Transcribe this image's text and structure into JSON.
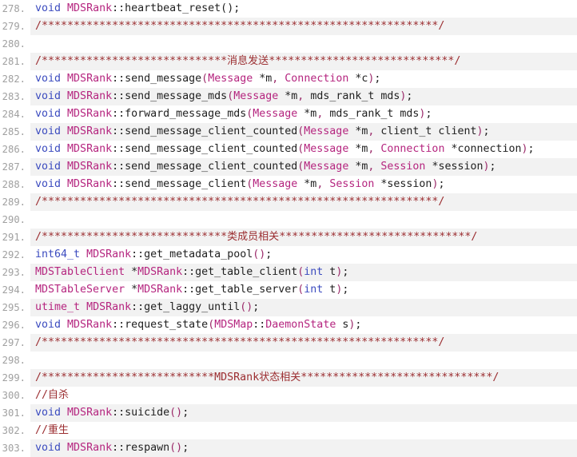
{
  "editor": {
    "language": "cpp",
    "first_line": 278,
    "last_line": 303,
    "gutter_separator": ".",
    "colors": {
      "background": "#ffffff",
      "stripe": "#f2f2f2",
      "line_number": "#a0a0a0",
      "keyword": "#3b4bbf",
      "class_name": "#b5257f",
      "comment": "#9b2d30",
      "punctuation": "#9b2a6a",
      "text": "#1f1f1f"
    }
  },
  "lines": [
    {
      "number": "278.",
      "tokens": [
        {
          "t": "void",
          "c": "kw"
        },
        {
          "t": " ",
          "c": "plain"
        },
        {
          "t": "MDSRank",
          "c": "cls"
        },
        {
          "t": "::heartbeat_reset();",
          "c": "plain"
        }
      ]
    },
    {
      "number": "279.",
      "tokens": [
        {
          "t": "/**************************************************************/",
          "c": "cmt"
        }
      ]
    },
    {
      "number": "280.",
      "tokens": []
    },
    {
      "number": "281.",
      "tokens": [
        {
          "t": "/*****************************",
          "c": "cmt"
        },
        {
          "t": "消息发送",
          "c": "cmt-cjk"
        },
        {
          "t": "*****************************/",
          "c": "cmt"
        }
      ]
    },
    {
      "number": "282.",
      "tokens": [
        {
          "t": "void",
          "c": "kw"
        },
        {
          "t": " ",
          "c": "plain"
        },
        {
          "t": "MDSRank",
          "c": "cls"
        },
        {
          "t": "::send_message",
          "c": "plain"
        },
        {
          "t": "(",
          "c": "punc"
        },
        {
          "t": "Message",
          "c": "cls"
        },
        {
          "t": " *m",
          "c": "plain"
        },
        {
          "t": ",",
          "c": "punc"
        },
        {
          "t": " ",
          "c": "plain"
        },
        {
          "t": "Connection",
          "c": "cls"
        },
        {
          "t": " *c",
          "c": "plain"
        },
        {
          "t": ")",
          "c": "punc"
        },
        {
          "t": ";",
          "c": "plain"
        }
      ]
    },
    {
      "number": "283.",
      "tokens": [
        {
          "t": "void",
          "c": "kw"
        },
        {
          "t": " ",
          "c": "plain"
        },
        {
          "t": "MDSRank",
          "c": "cls"
        },
        {
          "t": "::send_message_mds",
          "c": "plain"
        },
        {
          "t": "(",
          "c": "punc"
        },
        {
          "t": "Message",
          "c": "cls"
        },
        {
          "t": " *m",
          "c": "plain"
        },
        {
          "t": ",",
          "c": "punc"
        },
        {
          "t": " mds_rank_t mds",
          "c": "plain"
        },
        {
          "t": ")",
          "c": "punc"
        },
        {
          "t": ";",
          "c": "plain"
        }
      ]
    },
    {
      "number": "284.",
      "tokens": [
        {
          "t": "void",
          "c": "kw"
        },
        {
          "t": " ",
          "c": "plain"
        },
        {
          "t": "MDSRank",
          "c": "cls"
        },
        {
          "t": "::forward_message_mds",
          "c": "plain"
        },
        {
          "t": "(",
          "c": "punc"
        },
        {
          "t": "Message",
          "c": "cls"
        },
        {
          "t": " *m",
          "c": "plain"
        },
        {
          "t": ",",
          "c": "punc"
        },
        {
          "t": " mds_rank_t mds",
          "c": "plain"
        },
        {
          "t": ")",
          "c": "punc"
        },
        {
          "t": ";",
          "c": "plain"
        }
      ]
    },
    {
      "number": "285.",
      "tokens": [
        {
          "t": "void",
          "c": "kw"
        },
        {
          "t": " ",
          "c": "plain"
        },
        {
          "t": "MDSRank",
          "c": "cls"
        },
        {
          "t": "::send_message_client_counted",
          "c": "plain"
        },
        {
          "t": "(",
          "c": "punc"
        },
        {
          "t": "Message",
          "c": "cls"
        },
        {
          "t": " *m",
          "c": "plain"
        },
        {
          "t": ",",
          "c": "punc"
        },
        {
          "t": " client_t client",
          "c": "plain"
        },
        {
          "t": ")",
          "c": "punc"
        },
        {
          "t": ";",
          "c": "plain"
        }
      ]
    },
    {
      "number": "286.",
      "tokens": [
        {
          "t": "void",
          "c": "kw"
        },
        {
          "t": " ",
          "c": "plain"
        },
        {
          "t": "MDSRank",
          "c": "cls"
        },
        {
          "t": "::send_message_client_counted",
          "c": "plain"
        },
        {
          "t": "(",
          "c": "punc"
        },
        {
          "t": "Message",
          "c": "cls"
        },
        {
          "t": " *m",
          "c": "plain"
        },
        {
          "t": ",",
          "c": "punc"
        },
        {
          "t": " ",
          "c": "plain"
        },
        {
          "t": "Connection",
          "c": "cls"
        },
        {
          "t": " *connection",
          "c": "plain"
        },
        {
          "t": ")",
          "c": "punc"
        },
        {
          "t": ";",
          "c": "plain"
        }
      ]
    },
    {
      "number": "287.",
      "tokens": [
        {
          "t": "void",
          "c": "kw"
        },
        {
          "t": " ",
          "c": "plain"
        },
        {
          "t": "MDSRank",
          "c": "cls"
        },
        {
          "t": "::send_message_client_counted",
          "c": "plain"
        },
        {
          "t": "(",
          "c": "punc"
        },
        {
          "t": "Message",
          "c": "cls"
        },
        {
          "t": " *m",
          "c": "plain"
        },
        {
          "t": ",",
          "c": "punc"
        },
        {
          "t": " ",
          "c": "plain"
        },
        {
          "t": "Session",
          "c": "cls"
        },
        {
          "t": " *session",
          "c": "plain"
        },
        {
          "t": ")",
          "c": "punc"
        },
        {
          "t": ";",
          "c": "plain"
        }
      ]
    },
    {
      "number": "288.",
      "tokens": [
        {
          "t": "void",
          "c": "kw"
        },
        {
          "t": " ",
          "c": "plain"
        },
        {
          "t": "MDSRank",
          "c": "cls"
        },
        {
          "t": "::send_message_client",
          "c": "plain"
        },
        {
          "t": "(",
          "c": "punc"
        },
        {
          "t": "Message",
          "c": "cls"
        },
        {
          "t": " *m",
          "c": "plain"
        },
        {
          "t": ",",
          "c": "punc"
        },
        {
          "t": " ",
          "c": "plain"
        },
        {
          "t": "Session",
          "c": "cls"
        },
        {
          "t": " *session",
          "c": "plain"
        },
        {
          "t": ")",
          "c": "punc"
        },
        {
          "t": ";",
          "c": "plain"
        }
      ]
    },
    {
      "number": "289.",
      "tokens": [
        {
          "t": "/**************************************************************/",
          "c": "cmt"
        }
      ]
    },
    {
      "number": "290.",
      "tokens": []
    },
    {
      "number": "291.",
      "tokens": [
        {
          "t": "/*****************************",
          "c": "cmt"
        },
        {
          "t": "类成员相关",
          "c": "cmt-cjk"
        },
        {
          "t": "******************************/",
          "c": "cmt"
        }
      ]
    },
    {
      "number": "292.",
      "tokens": [
        {
          "t": "int64_t",
          "c": "kw"
        },
        {
          "t": " ",
          "c": "plain"
        },
        {
          "t": "MDSRank",
          "c": "cls"
        },
        {
          "t": "::get_metadata_pool",
          "c": "plain"
        },
        {
          "t": "(",
          "c": "punc"
        },
        {
          "t": ")",
          "c": "punc"
        },
        {
          "t": ";",
          "c": "plain"
        }
      ]
    },
    {
      "number": "293.",
      "tokens": [
        {
          "t": "MDSTableClient",
          "c": "cls"
        },
        {
          "t": " *",
          "c": "plain"
        },
        {
          "t": "MDSRank",
          "c": "cls"
        },
        {
          "t": "::get_table_client",
          "c": "plain"
        },
        {
          "t": "(",
          "c": "punc"
        },
        {
          "t": "int",
          "c": "kw"
        },
        {
          "t": " t",
          "c": "plain"
        },
        {
          "t": ")",
          "c": "punc"
        },
        {
          "t": ";",
          "c": "plain"
        }
      ]
    },
    {
      "number": "294.",
      "tokens": [
        {
          "t": "MDSTableServer",
          "c": "cls"
        },
        {
          "t": " *",
          "c": "plain"
        },
        {
          "t": "MDSRank",
          "c": "cls"
        },
        {
          "t": "::get_table_server",
          "c": "plain"
        },
        {
          "t": "(",
          "c": "punc"
        },
        {
          "t": "int",
          "c": "kw"
        },
        {
          "t": " t",
          "c": "plain"
        },
        {
          "t": ")",
          "c": "punc"
        },
        {
          "t": ";",
          "c": "plain"
        }
      ]
    },
    {
      "number": "295.",
      "tokens": [
        {
          "t": "utime_t",
          "c": "cls"
        },
        {
          "t": " ",
          "c": "plain"
        },
        {
          "t": "MDSRank",
          "c": "cls"
        },
        {
          "t": "::get_laggy_until",
          "c": "plain"
        },
        {
          "t": "(",
          "c": "punc"
        },
        {
          "t": ")",
          "c": "punc"
        },
        {
          "t": ";",
          "c": "plain"
        }
      ]
    },
    {
      "number": "296.",
      "tokens": [
        {
          "t": "void",
          "c": "kw"
        },
        {
          "t": " ",
          "c": "plain"
        },
        {
          "t": "MDSRank",
          "c": "cls"
        },
        {
          "t": "::request_state",
          "c": "plain"
        },
        {
          "t": "(",
          "c": "punc"
        },
        {
          "t": "MDSMap",
          "c": "cls"
        },
        {
          "t": "::",
          "c": "plain"
        },
        {
          "t": "DaemonState",
          "c": "cls"
        },
        {
          "t": " s",
          "c": "plain"
        },
        {
          "t": ")",
          "c": "punc"
        },
        {
          "t": ";",
          "c": "plain"
        }
      ]
    },
    {
      "number": "297.",
      "tokens": [
        {
          "t": "/**************************************************************/",
          "c": "cmt"
        }
      ]
    },
    {
      "number": "298.",
      "tokens": []
    },
    {
      "number": "299.",
      "tokens": [
        {
          "t": "/***************************",
          "c": "cmt"
        },
        {
          "t": "MDSRank",
          "c": "cmt"
        },
        {
          "t": "状态相关",
          "c": "cmt-cjk"
        },
        {
          "t": "******************************/",
          "c": "cmt"
        }
      ]
    },
    {
      "number": "300.",
      "tokens": [
        {
          "t": "//",
          "c": "cmt"
        },
        {
          "t": "自杀",
          "c": "cmt-cjk"
        }
      ]
    },
    {
      "number": "301.",
      "tokens": [
        {
          "t": "void",
          "c": "kw"
        },
        {
          "t": " ",
          "c": "plain"
        },
        {
          "t": "MDSRank",
          "c": "cls"
        },
        {
          "t": "::suicide",
          "c": "plain"
        },
        {
          "t": "(",
          "c": "punc"
        },
        {
          "t": ")",
          "c": "punc"
        },
        {
          "t": ";",
          "c": "plain"
        }
      ]
    },
    {
      "number": "302.",
      "tokens": [
        {
          "t": "//",
          "c": "cmt"
        },
        {
          "t": "重生",
          "c": "cmt-cjk"
        }
      ]
    },
    {
      "number": "303.",
      "tokens": [
        {
          "t": "void",
          "c": "kw"
        },
        {
          "t": " ",
          "c": "plain"
        },
        {
          "t": "MDSRank",
          "c": "cls"
        },
        {
          "t": "::respawn",
          "c": "plain"
        },
        {
          "t": "(",
          "c": "punc"
        },
        {
          "t": ")",
          "c": "punc"
        },
        {
          "t": ";",
          "c": "plain"
        }
      ]
    }
  ]
}
